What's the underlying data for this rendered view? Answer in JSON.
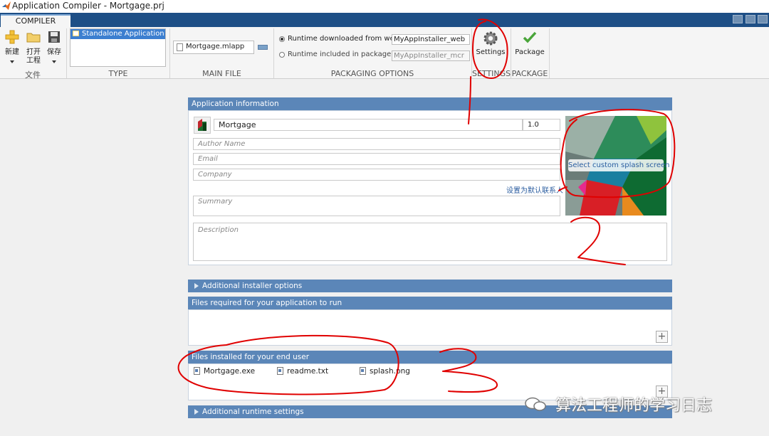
{
  "window": {
    "title": "Application Compiler - Mortgage.prj"
  },
  "ribbon": {
    "tab_label": "COMPILER",
    "file_group": {
      "label": "文件",
      "new_label": "新建",
      "open_label_line1": "打开",
      "open_label_line2": "工程",
      "save_label": "保存"
    },
    "type_group": {
      "label": "TYPE",
      "selected": "Standalone Application"
    },
    "main_file_group": {
      "label": "MAIN FILE",
      "file": "Mortgage.mlapp"
    },
    "packaging_group": {
      "label": "PACKAGING OPTIONS",
      "option_web_label": "Runtime downloaded from web",
      "option_web_value": "MyAppInstaller_web",
      "option_web_selected": true,
      "option_pkg_label": "Runtime included in package",
      "option_pkg_value": "MyAppInstaller_mcr",
      "option_pkg_selected": false
    },
    "settings_group": {
      "label": "SETTINGS",
      "button_label": "Settings"
    },
    "package_group": {
      "label": "PACKAGE",
      "button_label": "Package"
    }
  },
  "app_info": {
    "header": "Application information",
    "app_name": "Mortgage",
    "version": "1.0",
    "author_placeholder": "Author Name",
    "email_placeholder": "Email",
    "company_placeholder": "Company",
    "default_contact_link": "设置为默认联系人",
    "summary_placeholder": "Summary",
    "description_placeholder": "Description",
    "splash_label": "Select custom splash screen"
  },
  "sections": {
    "additional_installer": "Additional installer options",
    "files_required": "Files required for your application to run",
    "files_installed": "Files installed for your end user",
    "additional_runtime": "Additional runtime settings"
  },
  "installed_files": [
    "Mortgage.exe",
    "readme.txt",
    "splash.png"
  ],
  "plus_symbol": "+",
  "watermark": "算法工程师的学习日志",
  "colors": {
    "tab_bar": "#1e4f86",
    "panel_header": "#5b86b8",
    "annotation_red": "#e00000",
    "selection_blue": "#3c7fd0"
  }
}
